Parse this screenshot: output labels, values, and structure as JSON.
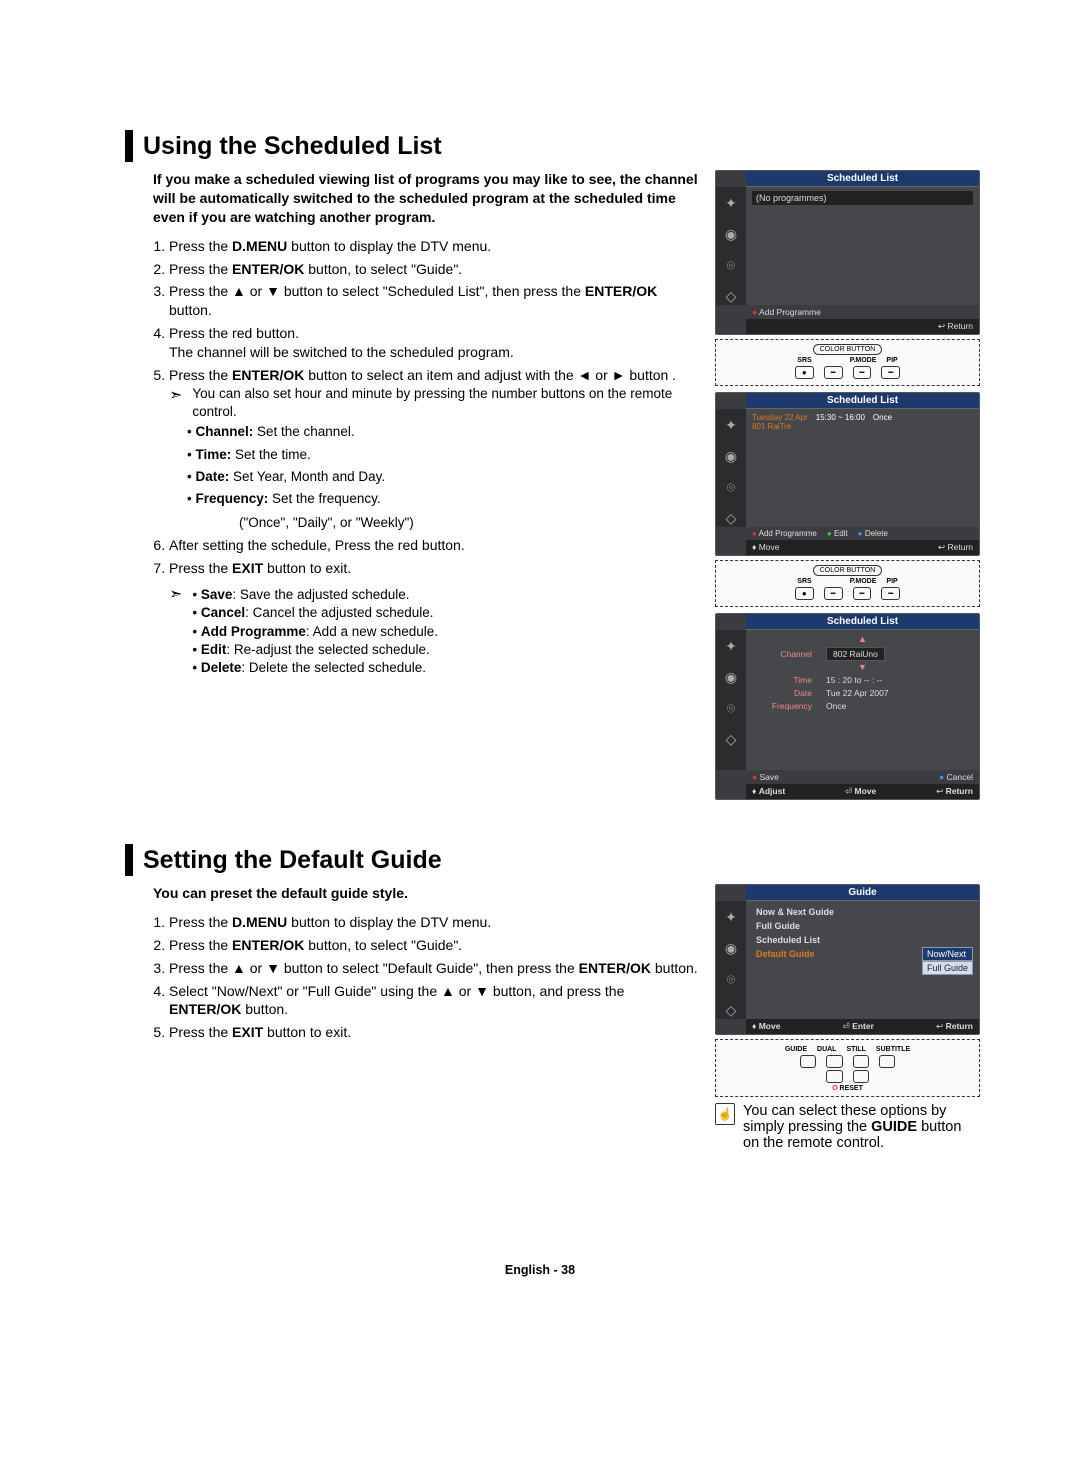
{
  "section1": {
    "title": "Using the Scheduled List",
    "intro": "If you make a scheduled viewing list of programs you may like to see, the channel will be automatically switched to the scheduled program at the scheduled time even if you are watching another program.",
    "steps": [
      "Press the <b>D.MENU</b> button to display the DTV menu.",
      "Press the <b>ENTER/OK</b> button, to select \"Guide\".",
      "Press the ▲ or ▼ button to select \"Scheduled List\", then press the <b>ENTER/OK</b> button.",
      "Press the red button.<br>The channel will be switched to the scheduled program.",
      "Press the <b>ENTER/OK</b> button to select an item and adjust with the ◄ or ► button .",
      "After setting the schedule, Press the red button.",
      "Press the <b>EXIT</b> button to exit."
    ],
    "note1_lead": "You can also set hour and minute by pressing the number buttons on the remote control.",
    "note1_items": [
      "<b>Channel:</b> Set the channel.",
      "<b>Time:</b> Set the time.",
      "<b>Date:</b> Set Year, Month and Day.",
      "<b>Frequency:</b> Set the frequency."
    ],
    "note1_tail": "(\"Once\", \"Daily\", or \"Weekly\")",
    "note2_items": [
      "<b>Save</b>: Save the adjusted schedule.",
      "<b>Cancel</b>: Cancel the adjusted schedule.",
      "<b>Add Programme</b>: Add a new schedule.",
      "<b>Edit</b>: Re-adjust the selected schedule.",
      "<b>Delete</b>: Delete the selected schedule."
    ],
    "tv1": {
      "header": "Scheduled List",
      "empty": "(No programmes)",
      "foot_add": "Add Programme",
      "foot_return": "↩ Return"
    },
    "tv2": {
      "header": "Scheduled List",
      "date": "Tuesday 22 Apr",
      "time": "15:30 ~ 16:00",
      "freq": "Once",
      "chan": "801 RaiTre",
      "foot_add": "Add Programme",
      "foot_edit": "Edit",
      "foot_del": "Delete",
      "foot_move": "Move",
      "foot_return": "Return"
    },
    "tv3": {
      "header": "Scheduled List",
      "channel_label": "Channel",
      "channel_val": "802 RaiUno",
      "time_label": "Time",
      "time_val": "15 : 20 to -- : --",
      "date_label": "Date",
      "date_val": "Tue 22 Apr 2007",
      "freq_label": "Frequency",
      "freq_val": "Once",
      "save": "Save",
      "cancel": "Cancel",
      "adjust": "Adjust",
      "move": "Move",
      "return": "Return"
    },
    "remote": {
      "header": "COLOR BUTTON",
      "b1": "SRS",
      "b2": "P.MODE",
      "b3": "PIP"
    }
  },
  "section2": {
    "title": "Setting the Default Guide",
    "intro": "You can preset the default guide style.",
    "steps": [
      "Press the <b>D.MENU</b> button to display the DTV menu.",
      "Press the <b>ENTER/OK</b> button, to select \"Guide\".",
      "Press the ▲ or ▼ button to select \"Default Guide\", then press the <b>ENTER/OK</b> button.",
      "Select \"Now/Next\" or \"Full Guide\" using the ▲ or ▼ button, and press the <b>ENTER/OK</b> button.",
      "Press the <b>EXIT</b> button to exit."
    ],
    "tv": {
      "header": "Guide",
      "opt1": "Now & Next Guide",
      "opt2": "Full Guide",
      "opt3": "Scheduled List",
      "opt4": "Default Guide",
      "sel1": "Now/Next",
      "sel2": "Full Guide",
      "move": "Move",
      "enter": "Enter",
      "return": "Return"
    },
    "remote2": {
      "b1": "GUIDE",
      "b2": "DUAL",
      "b3": "STILL",
      "b4": "SUBTITLE",
      "reset": "RESET"
    },
    "tip": "You can select these options by simply pressing the <b>GUIDE</b> button on the remote control."
  },
  "footer": "English - 38"
}
